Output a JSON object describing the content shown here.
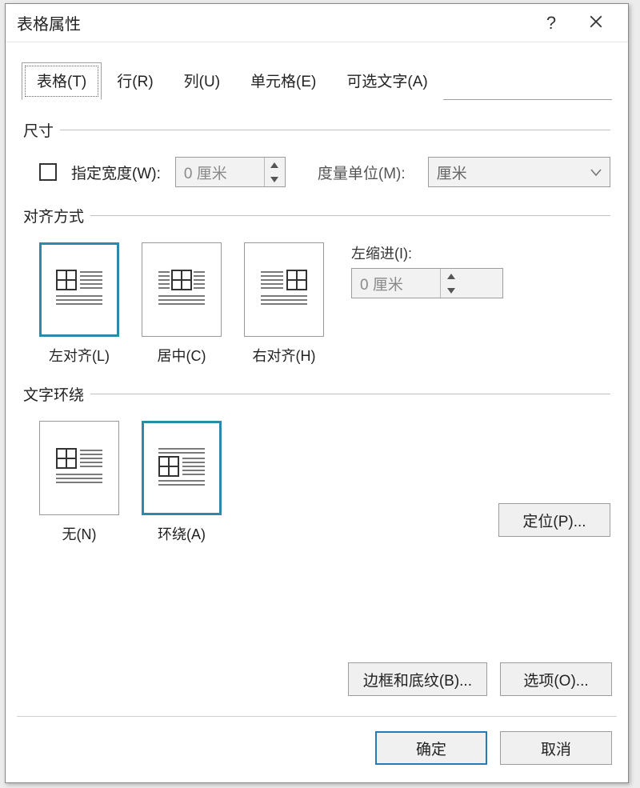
{
  "dialog": {
    "title": "表格属性",
    "help_glyph": "?",
    "close_aria": "Close"
  },
  "tabs": {
    "table": "表格(T)",
    "row": "行(R)",
    "column": "列(U)",
    "cell": "单元格(E)",
    "alttext": "可选文字(A)"
  },
  "size": {
    "legend": "尺寸",
    "specify_width_label": "指定宽度(W):",
    "width_value": "0 厘米",
    "unit_label": "度量单位(M):",
    "unit_value": "厘米"
  },
  "align": {
    "legend": "对齐方式",
    "left": "左对齐(L)",
    "center": "居中(C)",
    "right": "右对齐(H)",
    "indent_label": "左缩进(I):",
    "indent_value": "0 厘米"
  },
  "wrap": {
    "legend": "文字环绕",
    "none": "无(N)",
    "around": "环绕(A)",
    "position_btn": "定位(P)..."
  },
  "buttons": {
    "borders": "边框和底纹(B)...",
    "options": "选项(O)...",
    "ok": "确定",
    "cancel": "取消"
  }
}
